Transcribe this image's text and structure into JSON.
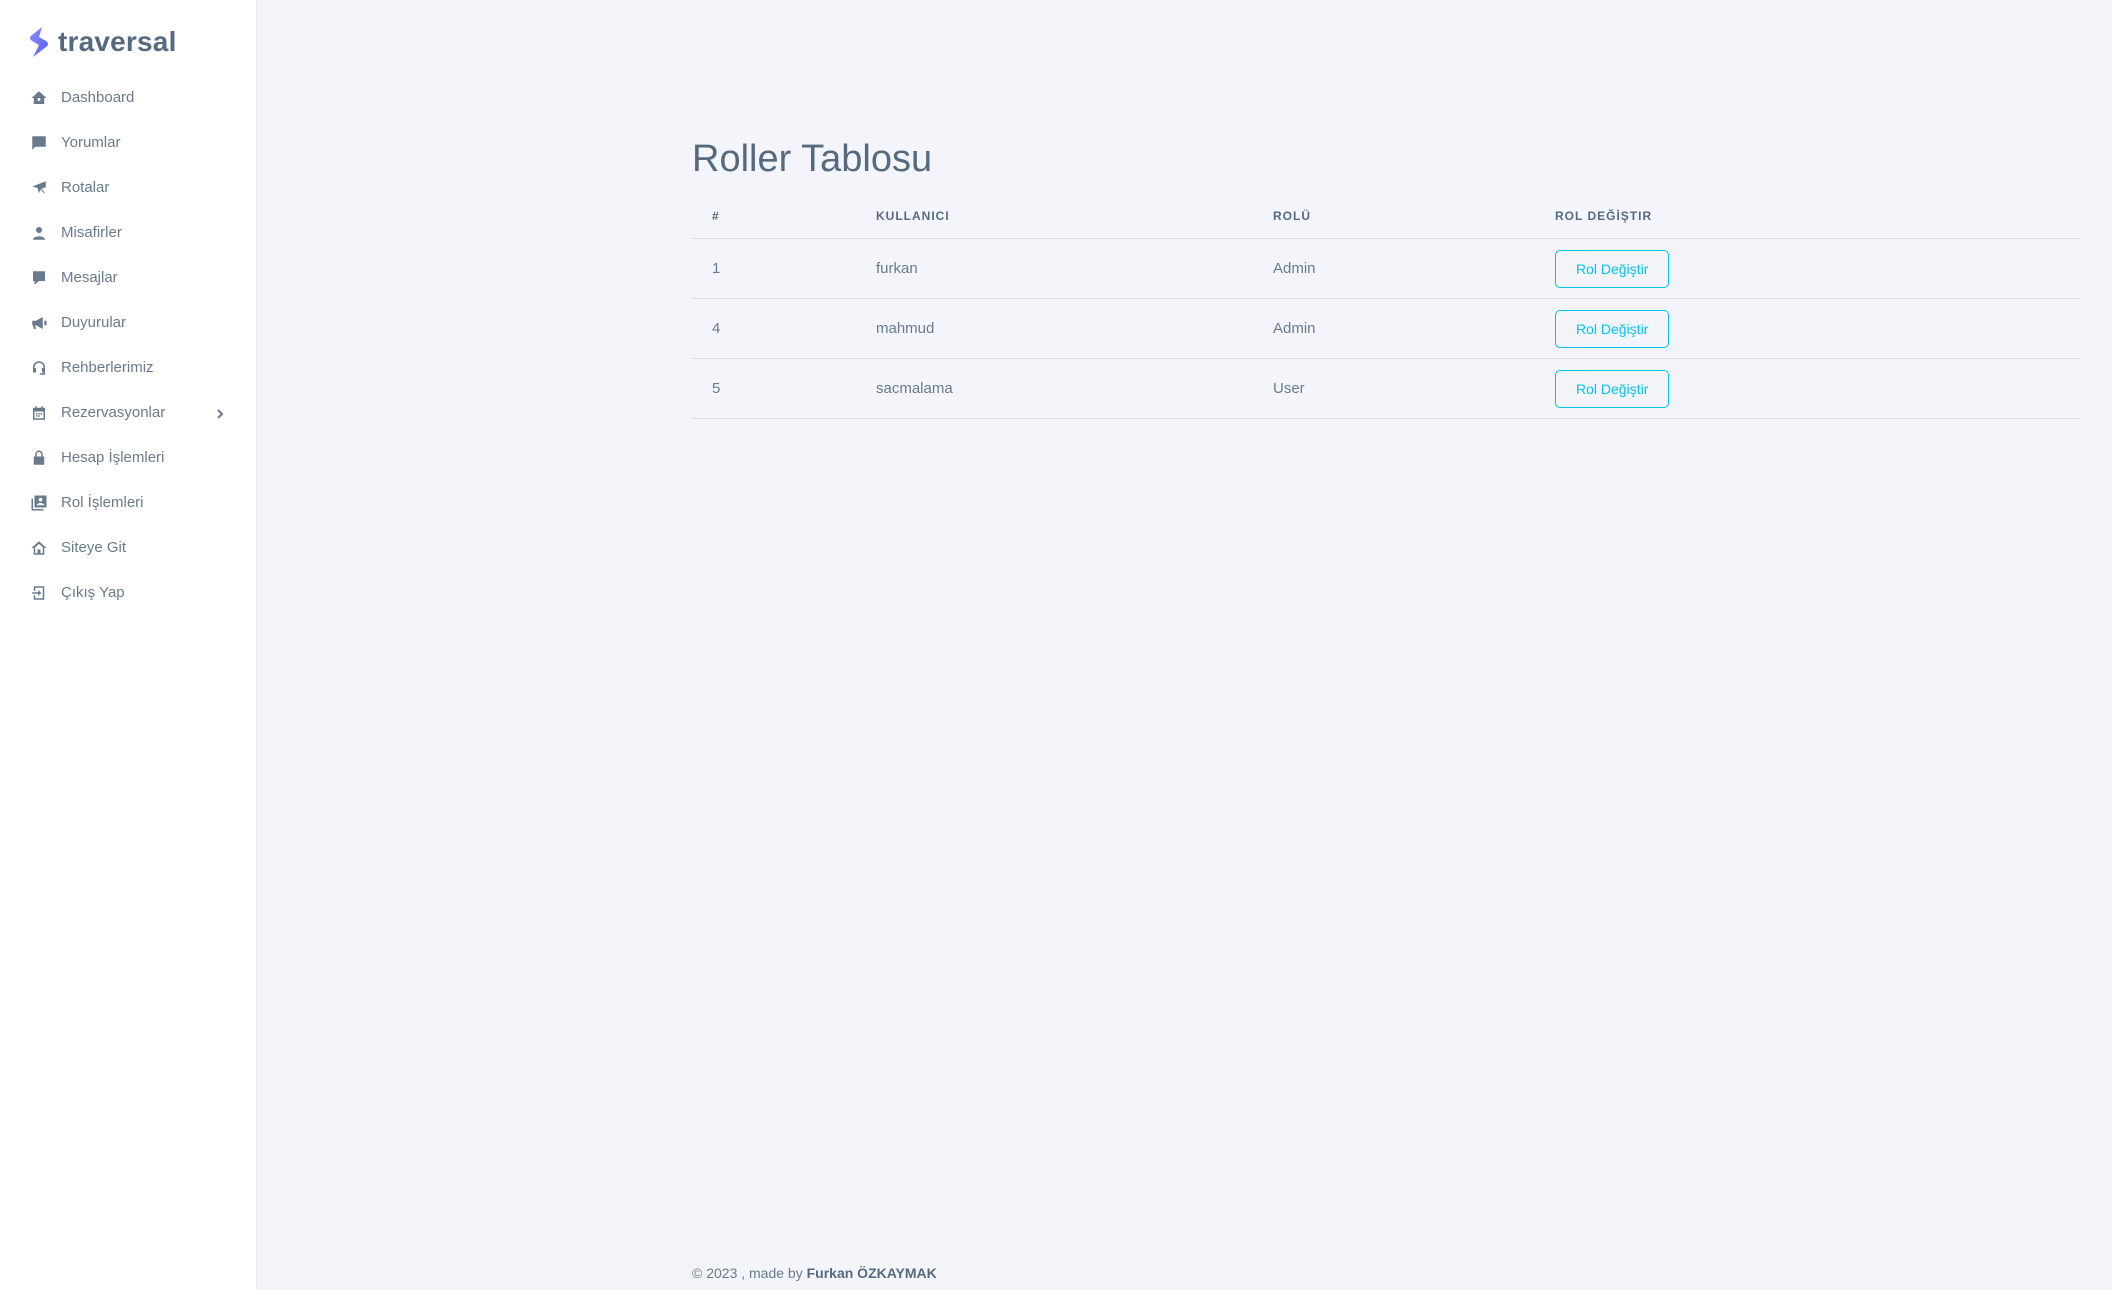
{
  "brand": {
    "name": "traversal"
  },
  "colors": {
    "accent": "#03c3ec",
    "brand": "#696cff",
    "text": "#566a7f"
  },
  "sidebar": {
    "items": [
      {
        "label": "Dashboard",
        "icon": "home-icon"
      },
      {
        "label": "Yorumlar",
        "icon": "comment-icon"
      },
      {
        "label": "Rotalar",
        "icon": "airplane-icon"
      },
      {
        "label": "Misafirler",
        "icon": "user-icon"
      },
      {
        "label": "Mesajlar",
        "icon": "message-icon"
      },
      {
        "label": "Duyurular",
        "icon": "megaphone-icon"
      },
      {
        "label": "Rehberlerimiz",
        "icon": "headset-icon"
      },
      {
        "label": "Rezervasyonlar",
        "icon": "calendar-icon",
        "has_submenu": true
      },
      {
        "label": "Hesap İşlemleri",
        "icon": "lock-icon"
      },
      {
        "label": "Rol İşlemleri",
        "icon": "id-card-icon"
      },
      {
        "label": "Siteye Git",
        "icon": "house-outline-icon"
      },
      {
        "label": "Çıkış Yap",
        "icon": "logout-icon"
      }
    ]
  },
  "main": {
    "title": "Roller Tablosu",
    "table": {
      "headers": [
        "#",
        "KULLANICI",
        "ROLÜ",
        "ROL DEĞİŞTIR"
      ],
      "rows": [
        {
          "id": "1",
          "user": "furkan",
          "role": "Admin",
          "action": "Rol Değiştir"
        },
        {
          "id": "4",
          "user": "mahmud",
          "role": "Admin",
          "action": "Rol Değiştir"
        },
        {
          "id": "5",
          "user": "sacmalama",
          "role": "User",
          "action": "Rol Değiştir"
        }
      ]
    }
  },
  "footer": {
    "prefix": "© 2023 , made by ",
    "author": "Furkan ÖZKAYMAK"
  }
}
